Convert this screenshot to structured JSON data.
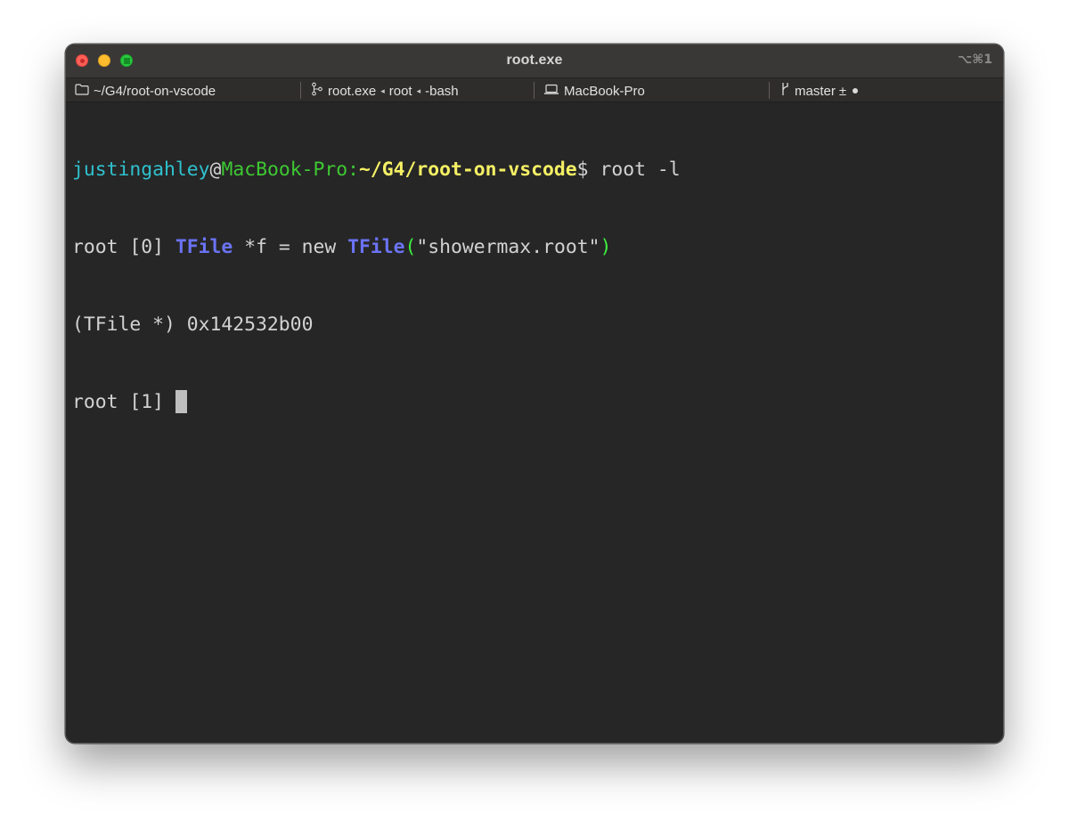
{
  "window": {
    "title": "root.exe",
    "shortcut": "⌥⌘1"
  },
  "statusbar": {
    "directory": "~/G4/root-on-vscode",
    "job": {
      "parts": [
        "root.exe",
        "root",
        "-bash"
      ],
      "separator": "◂"
    },
    "host": "MacBook-Pro",
    "git": {
      "branch": "master",
      "status": "±"
    }
  },
  "terminal": {
    "prompt": {
      "user": "justingahley",
      "at": "@",
      "host": "MacBook-Pro:",
      "path": "~/G4/root-on-vscode",
      "symbol": "$",
      "command": " root -l"
    },
    "line2": {
      "prefix": "root [0] ",
      "type1": "TFile",
      "middle": " *f = new ",
      "type2": "TFile",
      "paren_open": "(",
      "string": "\"showermax.root\"",
      "paren_close": ")"
    },
    "line3": "(TFile *) 0x142532b00",
    "line4": "root [1] "
  },
  "colors": {
    "user": "#2fc1ce",
    "host": "#3ec833",
    "path": "#f5f064",
    "keyword": "#6b73f4",
    "paren": "#3ef23e",
    "text": "#d2d2d2",
    "background": "#262626"
  },
  "icons": {
    "directory": "folder-icon",
    "job": "process-icon",
    "host": "laptop-icon",
    "git": "git-branch-icon"
  }
}
